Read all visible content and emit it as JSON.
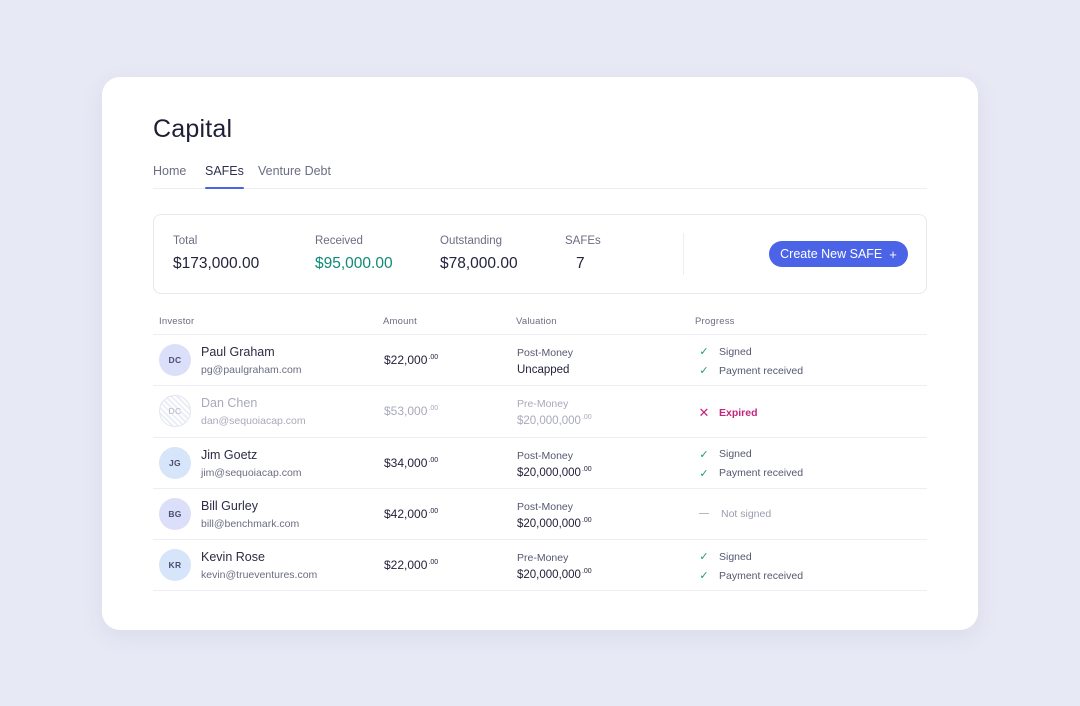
{
  "page": {
    "title": "Capital"
  },
  "tabs": [
    {
      "label": "Home",
      "active": false
    },
    {
      "label": "SAFEs",
      "active": true
    },
    {
      "label": "Venture Debt",
      "active": false
    }
  ],
  "summary": {
    "total": {
      "label": "Total",
      "value": "$173,000.00"
    },
    "received": {
      "label": "Received",
      "value": "$95,000.00",
      "color": "#0e8a76"
    },
    "outstanding": {
      "label": "Outstanding",
      "value": "$78,000.00"
    },
    "safes": {
      "label": "SAFEs",
      "value": "7"
    },
    "create_button": {
      "label": "Create New SAFE",
      "icon": "plus-icon",
      "color": "#4a63e7"
    }
  },
  "table": {
    "columns": {
      "investor": "Investor",
      "amount": "Amount",
      "valuation": "Valuation",
      "progress": "Progress"
    },
    "rows": [
      {
        "initials": "DC",
        "name": "Paul Graham",
        "email": "pg@paulgraham.com",
        "amount": "$22,000",
        "amount_cents": ".00",
        "valuation_type": "Post-Money",
        "valuation": "Uncapped",
        "valuation_cents": "",
        "status": "completed",
        "progress": [
          "Signed",
          "Payment received"
        ]
      },
      {
        "initials": "DC",
        "name": "Dan Chen",
        "email": "dan@sequoiacap.com",
        "amount": "$53,000",
        "amount_cents": ".00",
        "valuation_type": "Pre-Money",
        "valuation": "$20,000,000",
        "valuation_cents": ".00",
        "status": "expired",
        "progress": [
          "Expired"
        ]
      },
      {
        "initials": "JG",
        "name": "Jim Goetz",
        "email": "jim@sequoiacap.com",
        "amount": "$34,000",
        "amount_cents": ".00",
        "valuation_type": "Post-Money",
        "valuation": "$20,000,000",
        "valuation_cents": ".00",
        "status": "completed",
        "progress": [
          "Signed",
          "Payment received"
        ]
      },
      {
        "initials": "BG",
        "name": "Bill Gurley",
        "email": "bill@benchmark.com",
        "amount": "$42,000",
        "amount_cents": ".00",
        "valuation_type": "Post-Money",
        "valuation": "$20,000,000",
        "valuation_cents": ".00",
        "status": "not_signed",
        "progress": [
          "Not signed"
        ]
      },
      {
        "initials": "KR",
        "name": "Kevin Rose",
        "email": "kevin@trueventures.com",
        "amount": "$22,000",
        "amount_cents": ".00",
        "valuation_type": "Pre-Money",
        "valuation": "$20,000,000",
        "valuation_cents": ".00",
        "status": "completed",
        "progress": [
          "Signed",
          "Payment received"
        ]
      }
    ]
  },
  "colors": {
    "background": "#e7e9f5",
    "accent": "#4a63e7",
    "success": "#1a9a80",
    "danger": "#c3257a"
  }
}
